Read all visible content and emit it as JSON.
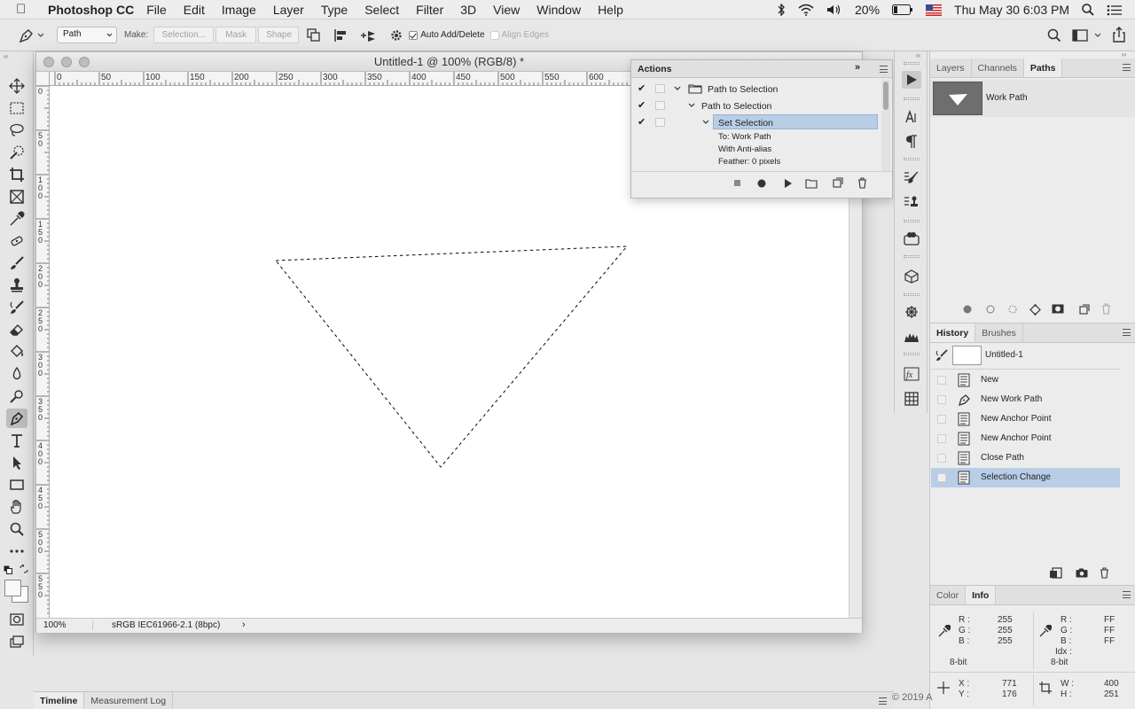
{
  "menubar": {
    "app_name": "Photoshop CC",
    "items": [
      "File",
      "Edit",
      "Image",
      "Layer",
      "Type",
      "Select",
      "Filter",
      "3D",
      "View",
      "Window",
      "Help"
    ],
    "battery": "20%",
    "clock": "Thu May 30  6:03 PM"
  },
  "options_bar": {
    "mode": "Path",
    "make_label": "Make:",
    "selection_btn": "Selection...",
    "mask_btn": "Mask",
    "shape_btn": "Shape",
    "auto_add_delete": "Auto Add/Delete",
    "align_edges": "Align Edges"
  },
  "document": {
    "title": "Untitled-1 @ 100% (RGB/8) *",
    "zoom": "100%",
    "profile": "sRGB IEC61966-2.1 (8bpc)",
    "h_ruler": [
      "0",
      "50",
      "100",
      "150",
      "200",
      "250",
      "300",
      "350",
      "400",
      "450",
      "500",
      "550",
      "600"
    ],
    "v_ruler": [
      "0",
      "50",
      "100",
      "150",
      "200",
      "250",
      "300",
      "350",
      "400",
      "450",
      "500",
      "550"
    ]
  },
  "actions_panel": {
    "title": "Actions",
    "rows": [
      {
        "label": "Path to Selection",
        "checked": true,
        "level": 0,
        "folder": true
      },
      {
        "label": "Path to Selection",
        "checked": true,
        "level": 1,
        "folder": false
      },
      {
        "label": "Set Selection",
        "checked": true,
        "level": 2,
        "folder": false,
        "selected": true
      }
    ],
    "details": [
      "To: Work Path",
      "With Anti-alias",
      "Feather: 0 pixels"
    ]
  },
  "paths_panel": {
    "tabs": [
      "Layers",
      "Channels",
      "Paths"
    ],
    "active_tab": "Paths",
    "items": [
      {
        "label": "Work Path"
      }
    ]
  },
  "history_panel": {
    "tabs": [
      "History",
      "Brushes"
    ],
    "active_tab": "History",
    "snapshot": "Untitled-1",
    "states": [
      {
        "label": "New",
        "icon": "document-icon"
      },
      {
        "label": "New Work Path",
        "icon": "pen-icon"
      },
      {
        "label": "New Anchor Point",
        "icon": "document-icon"
      },
      {
        "label": "New Anchor Point",
        "icon": "document-icon"
      },
      {
        "label": "Close Path",
        "icon": "document-icon"
      },
      {
        "label": "Selection Change",
        "icon": "document-icon",
        "selected": true
      }
    ]
  },
  "info_panel": {
    "tabs": [
      "Color",
      "Info"
    ],
    "active_tab": "Info",
    "rgb_labels": [
      "R :",
      "G :",
      "B :"
    ],
    "rgb_values": [
      "255",
      "255",
      "255"
    ],
    "hex_labels": [
      "R :",
      "G :",
      "B :"
    ],
    "hex_values": [
      "FF",
      "FF",
      "FF"
    ],
    "idx_label": "Idx :",
    "bit_depth_left": "8-bit",
    "bit_depth_right": "8-bit",
    "x_label": "X :",
    "x_value": "771",
    "y_label": "Y :",
    "y_value": "176",
    "w_label": "W :",
    "w_value": "400",
    "h_label": "H :",
    "h_value": "251"
  },
  "bottom_bar": {
    "tabs": [
      "Timeline",
      "Measurement Log"
    ],
    "copyright": "© 2019 A"
  },
  "colors": {
    "selection_highlight": "#b8cde6",
    "panel_bg": "#ececec"
  }
}
